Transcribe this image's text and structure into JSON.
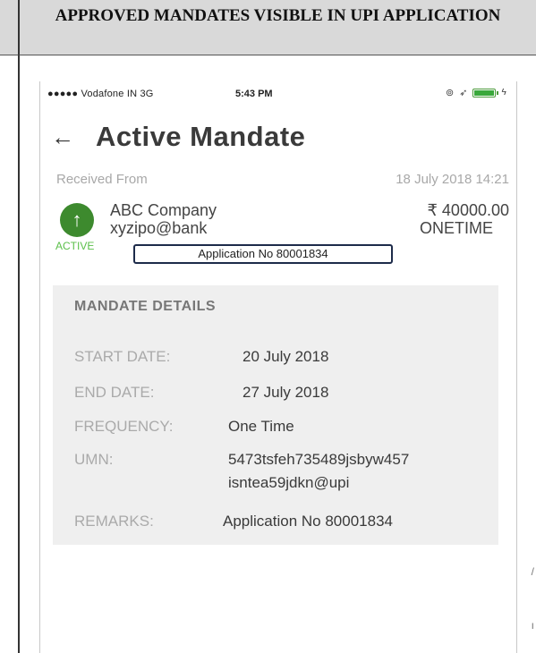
{
  "document": {
    "header_title": "APPROVED MANDATES VISIBLE IN UPI APPLICATION"
  },
  "status_bar": {
    "carrier": "●●●●● Vodafone IN  3G",
    "time": "5:43 PM",
    "alarm_icon": "⊚",
    "location_icon": "➶",
    "charge_icon": "ϟ",
    "battery_color": "#39a83b"
  },
  "screen": {
    "back_icon": "←",
    "title": "Active Mandate"
  },
  "mandate": {
    "received_label": "Received From",
    "received_date": "18 July 2018 14:21",
    "status_icon": "↑",
    "status_color": "#3d8a2e",
    "company": "ABC Company",
    "vpa": "xyzipo@bank",
    "amount": "₹ 40000.00",
    "type": "ONETIME",
    "status_text": "ACTIVE",
    "application_note": "Application No 80001834"
  },
  "details": {
    "heading": "MANDATE DETAILS",
    "start_label": "START DATE:",
    "start_value": "20 July 2018",
    "end_label": "END DATE:",
    "end_value": "27 July 2018",
    "frequency_label": "FREQUENCY:",
    "frequency_value": "One Time",
    "umn_label": "UMN:",
    "umn_value_line1": "5473tsfeh735489jsbyw457",
    "umn_value_line2": "isntea59jdkn@upi",
    "remarks_label": "REMARKS:",
    "remarks_value": "Application No 80001834"
  },
  "margin": {
    "tick1": "/",
    "tick2": "ı"
  }
}
